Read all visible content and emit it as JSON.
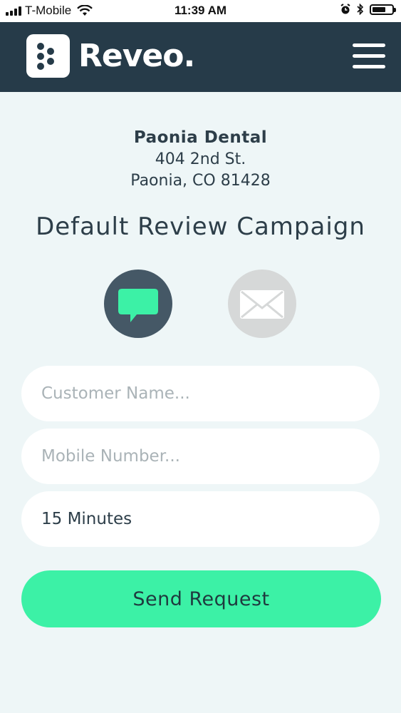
{
  "status_bar": {
    "carrier": "T-Mobile",
    "time": "11:39 AM",
    "battery_level": 0.7
  },
  "header": {
    "brand": "Reveo.",
    "logo_icon": "reveo-logo-icon",
    "menu_icon": "hamburger-menu-icon"
  },
  "business": {
    "name": "Paonia Dental",
    "address_line1": "404 2nd St.",
    "address_line2": "Paonia, CO 81428"
  },
  "campaign": {
    "title": "Default Review Campaign"
  },
  "channels": {
    "sms": {
      "icon": "chat-bubble-icon",
      "selected": true,
      "color": "#3cf1a6"
    },
    "email": {
      "icon": "envelope-icon",
      "selected": false
    }
  },
  "form": {
    "customer_name_placeholder": "Customer Name...",
    "mobile_number_placeholder": "Mobile Number...",
    "delay_value": "15 Minutes",
    "send_label": "Send Request"
  },
  "colors": {
    "header_bg": "#263b49",
    "accent": "#3cf1a6",
    "page_bg": "#eef6f7"
  }
}
